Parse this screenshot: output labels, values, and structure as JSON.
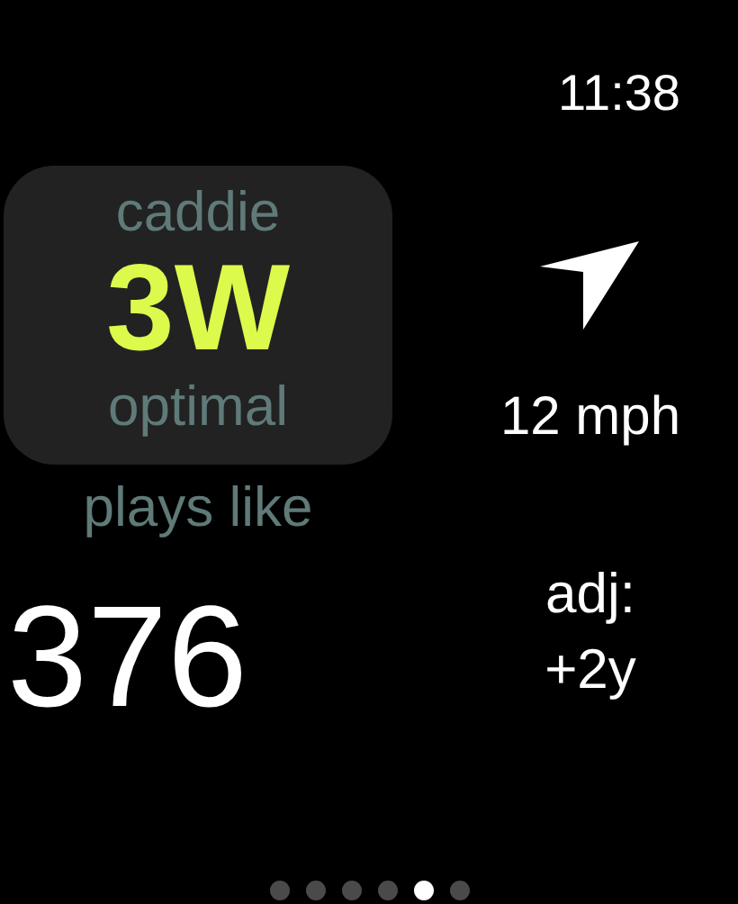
{
  "status_bar": {
    "time": "11:38"
  },
  "club_card": {
    "label": "caddie",
    "club": "3W",
    "note": "optimal"
  },
  "plays_like": {
    "label": "plays like",
    "distance": "376"
  },
  "wind": {
    "speed": "12 mph"
  },
  "adjustment": {
    "label": "adj:",
    "value": "+2y"
  },
  "pages": [
    {
      "selected": false
    },
    {
      "selected": false
    },
    {
      "selected": false
    },
    {
      "selected": false
    },
    {
      "selected": true
    },
    {
      "selected": false
    }
  ]
}
